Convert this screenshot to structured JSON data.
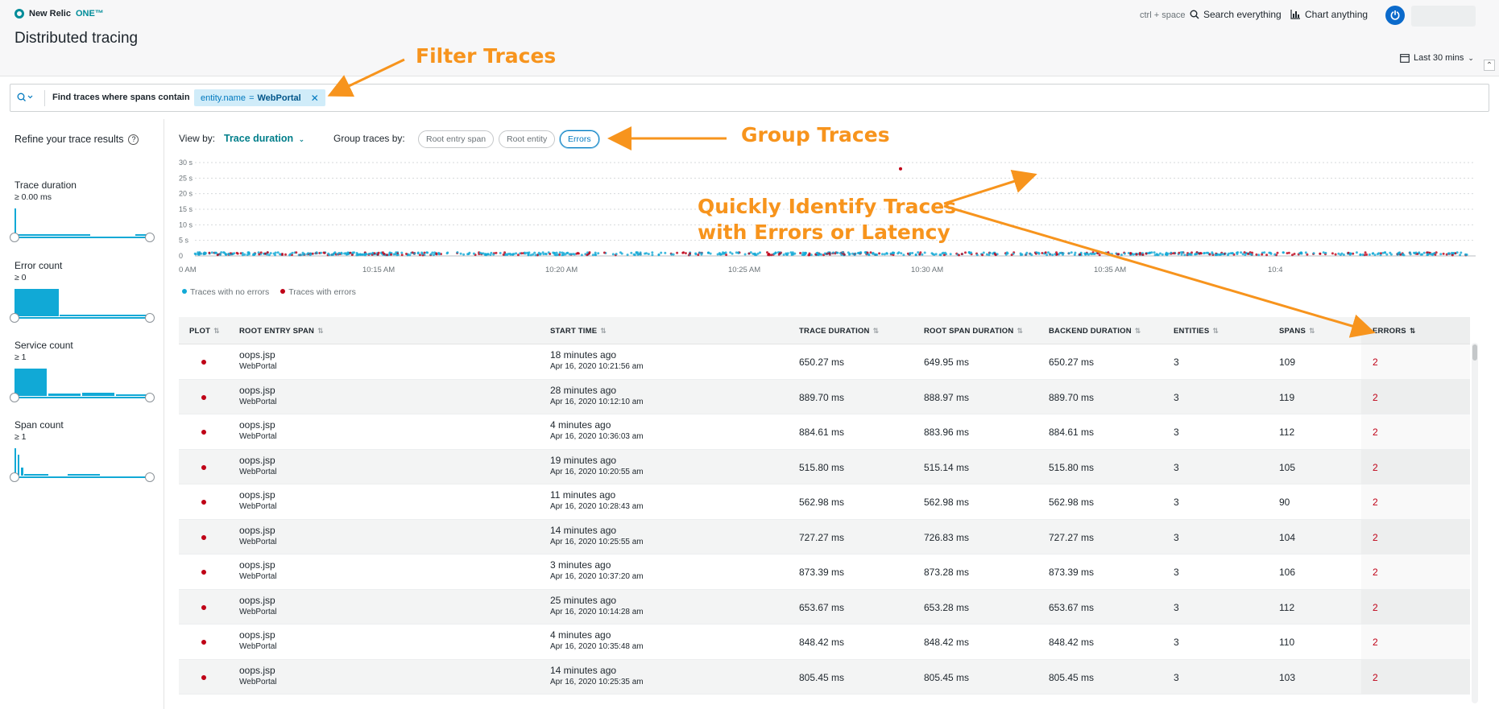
{
  "header": {
    "logo_text": "New Relic",
    "logo_one": "ONE™",
    "page_title": "Distributed tracing",
    "shortcut_hint": "ctrl + space",
    "search_label": "Search everything",
    "chart_label": "Chart anything",
    "time_range": "Last 30 mins"
  },
  "filter": {
    "label": "Find traces where spans contain",
    "chip_key": "entity.name",
    "chip_op": "=",
    "chip_value": "WebPortal"
  },
  "sidebar": {
    "refine_label": "Refine your trace results",
    "facets": [
      {
        "title": "Trace duration",
        "sub": "≥ 0.00 ms"
      },
      {
        "title": "Error count",
        "sub": "≥ 0"
      },
      {
        "title": "Service count",
        "sub": "≥ 1"
      },
      {
        "title": "Span count",
        "sub": "≥ 1"
      }
    ]
  },
  "toolbar": {
    "view_by_label": "View by:",
    "view_by_value": "Trace duration",
    "group_by_label": "Group traces by:",
    "group_options": [
      "Root entry span",
      "Root entity",
      "Errors"
    ],
    "active_group": "Errors"
  },
  "chart_data": {
    "type": "scatter",
    "y_ticks": [
      "30 s",
      "25 s",
      "20 s",
      "15 s",
      "10 s",
      "5 s",
      "0"
    ],
    "x_ticks": [
      "0 AM",
      "10:15 AM",
      "10:20 AM",
      "10:25 AM",
      "10:30 AM",
      "10:35 AM",
      "10:4"
    ],
    "ylim": [
      0,
      30
    ],
    "legend": [
      "Traces with no errors",
      "Traces with errors"
    ],
    "colors": {
      "no_errors": "#11a9d6",
      "errors": "#bf0016"
    },
    "outlier": {
      "x": "10:30 AM",
      "y_seconds": 28
    }
  },
  "table": {
    "columns": [
      "PLOT",
      "ROOT ENTRY SPAN",
      "START TIME",
      "TRACE DURATION",
      "ROOT SPAN DURATION",
      "BACKEND DURATION",
      "ENTITIES",
      "SPANS",
      "ERRORS"
    ],
    "rows": [
      {
        "span": "oops.jsp",
        "entity": "WebPortal",
        "ago": "18 minutes ago",
        "ts": "Apr 16, 2020 10:21:56 am",
        "trace": "650.27 ms",
        "root": "649.95 ms",
        "backend": "650.27 ms",
        "entities": "3",
        "spans": "109",
        "errors": "2"
      },
      {
        "span": "oops.jsp",
        "entity": "WebPortal",
        "ago": "28 minutes ago",
        "ts": "Apr 16, 2020 10:12:10 am",
        "trace": "889.70 ms",
        "root": "888.97 ms",
        "backend": "889.70 ms",
        "entities": "3",
        "spans": "119",
        "errors": "2"
      },
      {
        "span": "oops.jsp",
        "entity": "WebPortal",
        "ago": "4 minutes ago",
        "ts": "Apr 16, 2020 10:36:03 am",
        "trace": "884.61 ms",
        "root": "883.96 ms",
        "backend": "884.61 ms",
        "entities": "3",
        "spans": "112",
        "errors": "2"
      },
      {
        "span": "oops.jsp",
        "entity": "WebPortal",
        "ago": "19 minutes ago",
        "ts": "Apr 16, 2020 10:20:55 am",
        "trace": "515.80 ms",
        "root": "515.14 ms",
        "backend": "515.80 ms",
        "entities": "3",
        "spans": "105",
        "errors": "2"
      },
      {
        "span": "oops.jsp",
        "entity": "WebPortal",
        "ago": "11 minutes ago",
        "ts": "Apr 16, 2020 10:28:43 am",
        "trace": "562.98 ms",
        "root": "562.98 ms",
        "backend": "562.98 ms",
        "entities": "3",
        "spans": "90",
        "errors": "2"
      },
      {
        "span": "oops.jsp",
        "entity": "WebPortal",
        "ago": "14 minutes ago",
        "ts": "Apr 16, 2020 10:25:55 am",
        "trace": "727.27 ms",
        "root": "726.83 ms",
        "backend": "727.27 ms",
        "entities": "3",
        "spans": "104",
        "errors": "2"
      },
      {
        "span": "oops.jsp",
        "entity": "WebPortal",
        "ago": "3 minutes ago",
        "ts": "Apr 16, 2020 10:37:20 am",
        "trace": "873.39 ms",
        "root": "873.28 ms",
        "backend": "873.39 ms",
        "entities": "3",
        "spans": "106",
        "errors": "2"
      },
      {
        "span": "oops.jsp",
        "entity": "WebPortal",
        "ago": "25 minutes ago",
        "ts": "Apr 16, 2020 10:14:28 am",
        "trace": "653.67 ms",
        "root": "653.28 ms",
        "backend": "653.67 ms",
        "entities": "3",
        "spans": "112",
        "errors": "2"
      },
      {
        "span": "oops.jsp",
        "entity": "WebPortal",
        "ago": "4 minutes ago",
        "ts": "Apr 16, 2020 10:35:48 am",
        "trace": "848.42 ms",
        "root": "848.42 ms",
        "backend": "848.42 ms",
        "entities": "3",
        "spans": "110",
        "errors": "2"
      },
      {
        "span": "oops.jsp",
        "entity": "WebPortal",
        "ago": "14 minutes ago",
        "ts": "Apr 16, 2020 10:25:35 am",
        "trace": "805.45 ms",
        "root": "805.45 ms",
        "backend": "805.45 ms",
        "entities": "3",
        "spans": "103",
        "errors": "2"
      }
    ]
  },
  "annotations": {
    "filter": "Filter Traces",
    "group": "Group Traces",
    "identify_line1": "Quickly Identify Traces",
    "identify_line2": "with Errors or Latency",
    "color": "#f7941d"
  }
}
